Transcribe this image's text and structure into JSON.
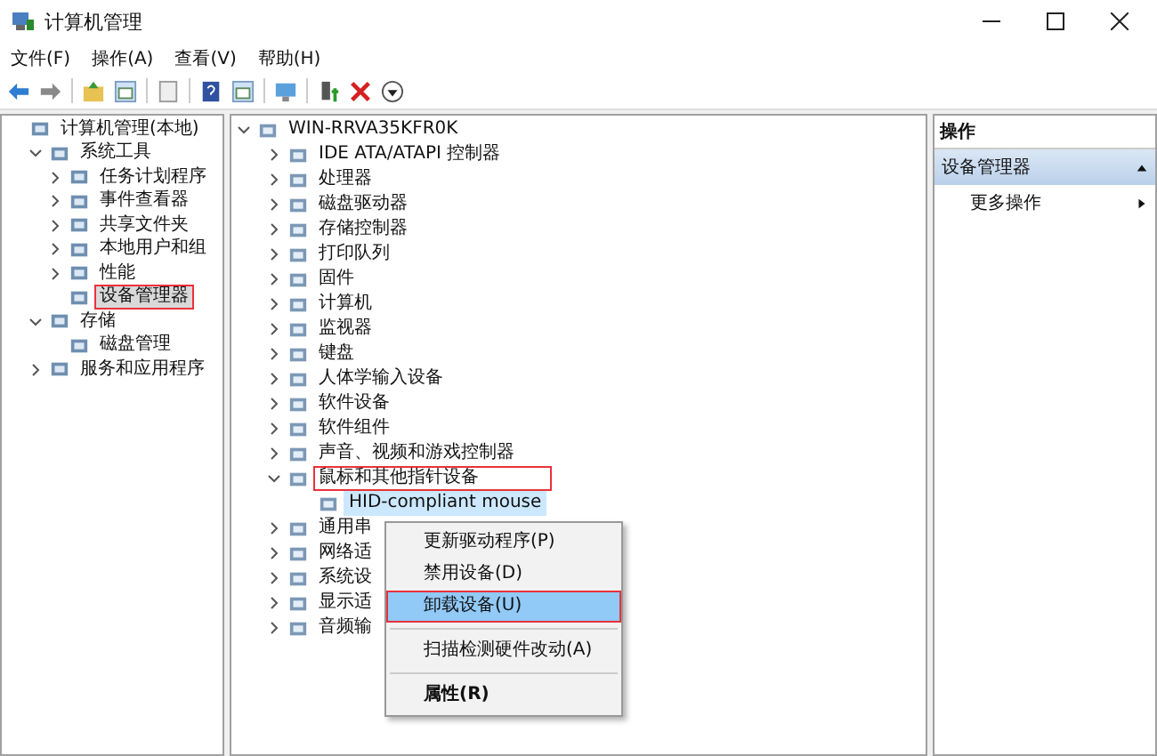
{
  "window": {
    "title": "计算机管理"
  },
  "menu_bar": [
    "文件(F)",
    "操作(A)",
    "查看(V)",
    "帮助(H)"
  ],
  "left_tree": [
    {
      "label": "计算机管理(本地)",
      "selected": false,
      "annotated": false,
      "children": [
        {
          "label": "系统工具",
          "expanded": true,
          "selected": false,
          "annotated": false,
          "children": [
            {
              "label": "任务计划程序",
              "expanded": false,
              "selected": false,
              "annotated": false
            },
            {
              "label": "事件查看器",
              "expanded": false,
              "selected": false,
              "annotated": false
            },
            {
              "label": "共享文件夹",
              "expanded": false,
              "selected": false,
              "annotated": false
            },
            {
              "label": "本地用户和组",
              "expanded": false,
              "selected": false,
              "annotated": false
            },
            {
              "label": "性能",
              "expanded": false,
              "selected": false,
              "annotated": false
            },
            {
              "label": "设备管理器",
              "selected": true,
              "annotated": true
            }
          ]
        },
        {
          "label": "存储",
          "expanded": true,
          "selected": false,
          "annotated": false,
          "children": [
            {
              "label": "磁盘管理",
              "selected": false,
              "annotated": false
            }
          ]
        },
        {
          "label": "服务和应用程序",
          "expanded": false,
          "selected": false,
          "annotated": false
        }
      ]
    }
  ],
  "device_tree": [
    {
      "label": "WIN-RRVA35KFR0K",
      "expanded": true,
      "selected": false,
      "annotated": false,
      "children": [
        {
          "label": "IDE ATA/ATAPI 控制器",
          "expanded": false,
          "selected": false,
          "annotated": false
        },
        {
          "label": "处理器",
          "expanded": false,
          "selected": false,
          "annotated": false
        },
        {
          "label": "磁盘驱动器",
          "expanded": false,
          "selected": false,
          "annotated": false
        },
        {
          "label": "存储控制器",
          "expanded": false,
          "selected": false,
          "annotated": false
        },
        {
          "label": "打印队列",
          "expanded": false,
          "selected": false,
          "annotated": false
        },
        {
          "label": "固件",
          "expanded": false,
          "selected": false,
          "annotated": false
        },
        {
          "label": "计算机",
          "expanded": false,
          "selected": false,
          "annotated": false
        },
        {
          "label": "监视器",
          "expanded": false,
          "selected": false,
          "annotated": false
        },
        {
          "label": "键盘",
          "expanded": false,
          "selected": false,
          "annotated": false
        },
        {
          "label": "人体学输入设备",
          "expanded": false,
          "selected": false,
          "annotated": false
        },
        {
          "label": "软件设备",
          "expanded": false,
          "selected": false,
          "annotated": false
        },
        {
          "label": "软件组件",
          "expanded": false,
          "selected": false,
          "annotated": false
        },
        {
          "label": "声音、视频和游戏控制器",
          "expanded": false,
          "selected": false,
          "annotated": false
        },
        {
          "label": "鼠标和其他指针设备",
          "expanded": true,
          "selected": false,
          "annotated": true,
          "children": [
            {
              "label": "HID-compliant mouse",
              "selected": true,
              "annotated": false
            }
          ]
        },
        {
          "label": "通用串",
          "expanded": false,
          "selected": false,
          "annotated": false
        },
        {
          "label": "网络适",
          "expanded": false,
          "selected": false,
          "annotated": false
        },
        {
          "label": "系统设",
          "expanded": false,
          "selected": false,
          "annotated": false
        },
        {
          "label": "显示适",
          "expanded": false,
          "selected": false,
          "annotated": false
        },
        {
          "label": "音频输",
          "expanded": false,
          "selected": false,
          "annotated": false
        }
      ]
    }
  ],
  "context_menu": [
    {
      "kind": "item",
      "label": "更新驱动程序(P)",
      "selected": false,
      "annotated": false
    },
    {
      "kind": "item",
      "label": "禁用设备(D)",
      "selected": false,
      "annotated": false
    },
    {
      "kind": "item",
      "label": "卸载设备(U)",
      "selected": true,
      "annotated": true
    },
    {
      "kind": "separator"
    },
    {
      "kind": "item",
      "label": "扫描检测硬件改动(A)",
      "selected": false,
      "annotated": false
    },
    {
      "kind": "separator"
    },
    {
      "kind": "default",
      "label": "属性(R)",
      "selected": false,
      "annotated": false
    }
  ],
  "actions_pane": {
    "title": "操作",
    "section": "设备管理器",
    "items": [
      "更多操作"
    ]
  }
}
